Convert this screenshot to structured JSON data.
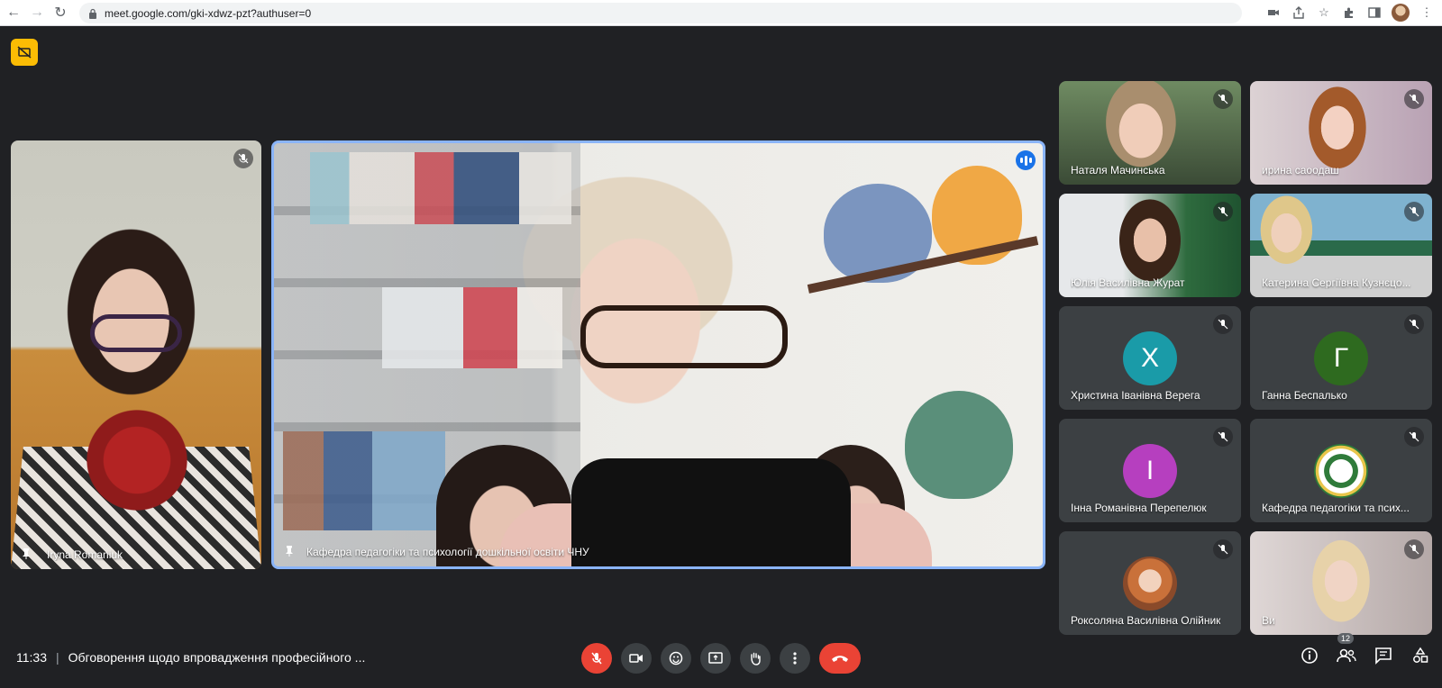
{
  "browser": {
    "url": "meet.google.com/gki-xdwz-pzt?authuser=0"
  },
  "participants": {
    "left": {
      "name": "Iryna Romaniuk"
    },
    "main": {
      "name": "Кафедра педагогіки та психології дошкільної освіти ЧНУ"
    },
    "grid": [
      {
        "name": "Наталя Мачинська"
      },
      {
        "name": "ирина саоодаш"
      },
      {
        "name": "Юлія Василівна Журат"
      },
      {
        "name": "Катерина Сергіївна Кузнєцо..."
      },
      {
        "name": "Христина Іванівна Верега",
        "initial": "Х",
        "color": "#1a9ba8"
      },
      {
        "name": "Ганна Беспалько",
        "initial": "Г",
        "color": "#2e6a1f"
      },
      {
        "name": "Інна Романівна Перепелюк",
        "initial": "І",
        "color": "#b63fbf"
      },
      {
        "name": "Кафедра педагогіки та псих..."
      },
      {
        "name": "Роксоляна Василівна Олійник"
      },
      {
        "name": "Ви"
      }
    ]
  },
  "bottom": {
    "time": "11:33",
    "separator": "|",
    "title": "Обговорення щодо впровадження професійного ...",
    "participant_count": "12"
  },
  "colors": {
    "accent": "#8ab4f8",
    "danger": "#ea4335",
    "speaking": "#1a73e8",
    "badge": "#fbbc04"
  },
  "icons": [
    "back-icon",
    "forward-icon",
    "reload-icon",
    "lock-icon",
    "camera-blocked-icon",
    "share-icon",
    "star-icon",
    "extensions-icon",
    "sidepanel-icon",
    "profile-avatar",
    "menu-icon",
    "mic-off-icon",
    "speaking-icon",
    "pin-icon",
    "camera-icon",
    "emoji-icon",
    "present-icon",
    "raise-hand-icon",
    "more-icon",
    "end-call-icon",
    "info-icon",
    "people-icon",
    "chat-icon",
    "activities-icon"
  ]
}
